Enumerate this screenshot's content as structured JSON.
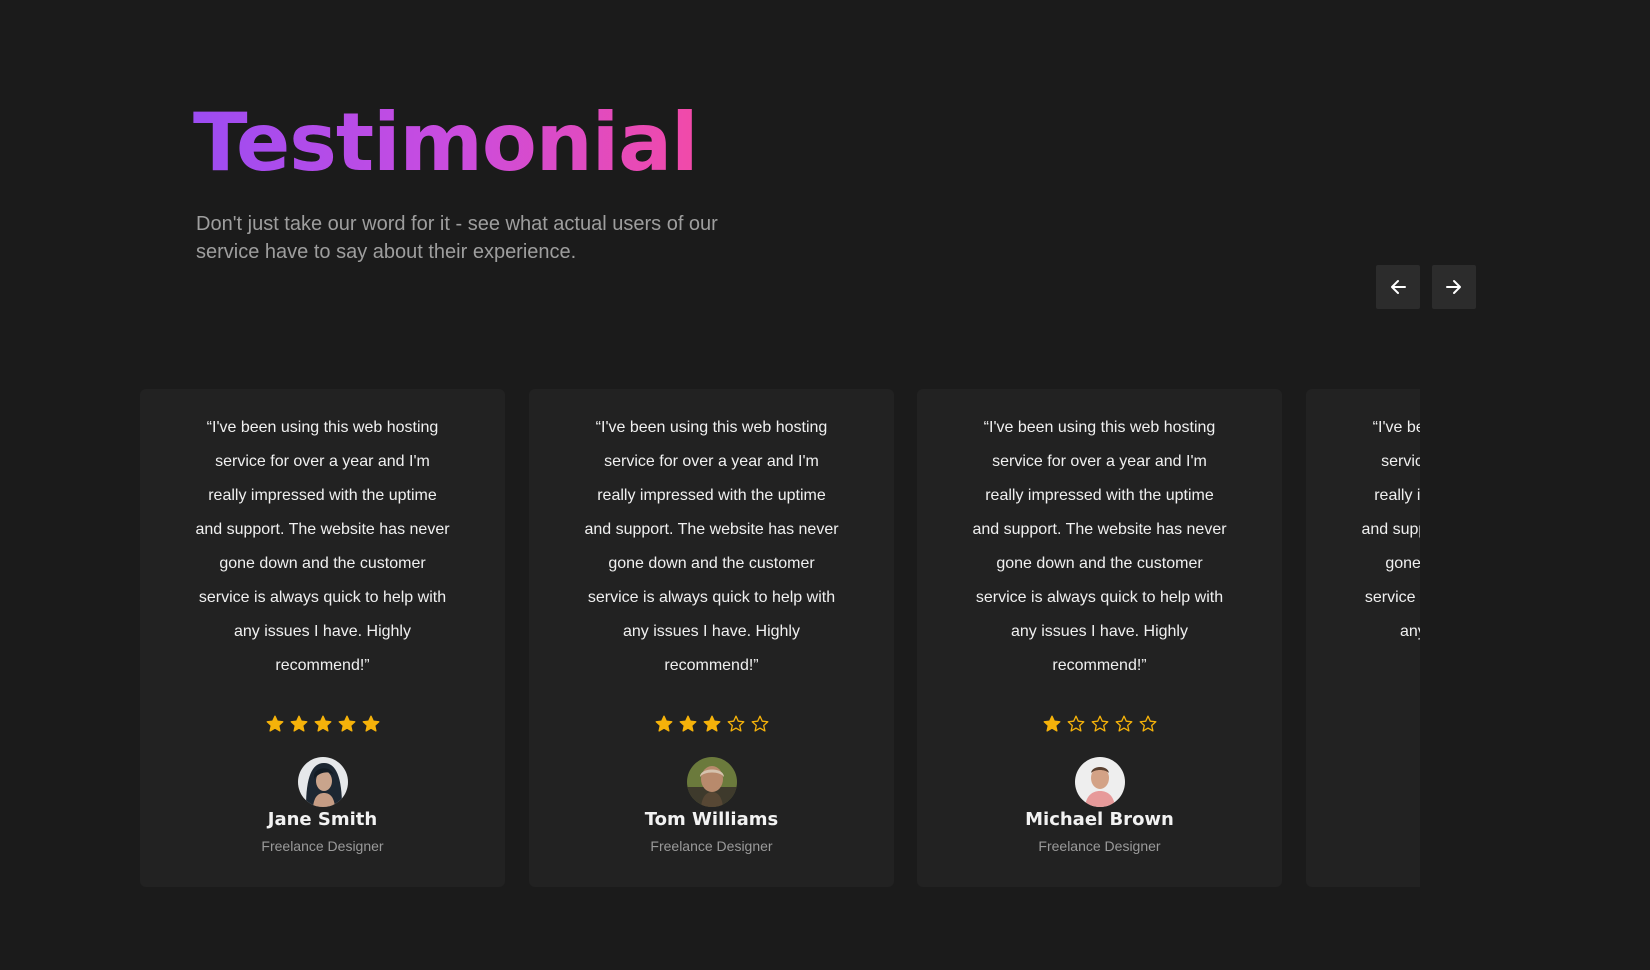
{
  "header": {
    "title": "Testimonial",
    "subtitle": "Don't just take our word for it - see what actual users of our service have to say about their experience."
  },
  "nav": {
    "prev_icon": "arrow-left-icon",
    "next_icon": "arrow-right-icon"
  },
  "colors": {
    "background": "#1b1b1b",
    "card": "#222222",
    "star": "#f5b20a",
    "title_gradient_start": "#9c4cf2",
    "title_gradient_end": "#f24aa8"
  },
  "testimonials": [
    {
      "quote": "“I've been using this web hosting service for over a year and I'm really impressed with the uptime and support. The website has never gone down and the customer service is always quick to help with any issues I have. Highly recommend!”",
      "rating": 5,
      "name": "Jane Smith",
      "role": "Freelance Designer"
    },
    {
      "quote": "“I've been using this web hosting service for over a year and I'm really impressed with the uptime and support. The website has never gone down and the customer service is always quick to help with any issues I have. Highly recommend!”",
      "rating": 3,
      "name": "Tom Williams",
      "role": "Freelance Designer"
    },
    {
      "quote": "“I've been using this web hosting service for over a year and I'm really impressed with the uptime and support. The website has never gone down and the customer service is always quick to help with any issues I have. Highly recommend!”",
      "rating": 1,
      "name": "Michael Brown",
      "role": "Freelance Designer"
    },
    {
      "quote": "“I've been using this web hosting service for over a year and I'm really impressed with the uptime and support. The website has never gone down and the customer service is always quick to help with any issues I have. Highly recommend!”",
      "rating": 0,
      "name": "",
      "role": ""
    }
  ]
}
